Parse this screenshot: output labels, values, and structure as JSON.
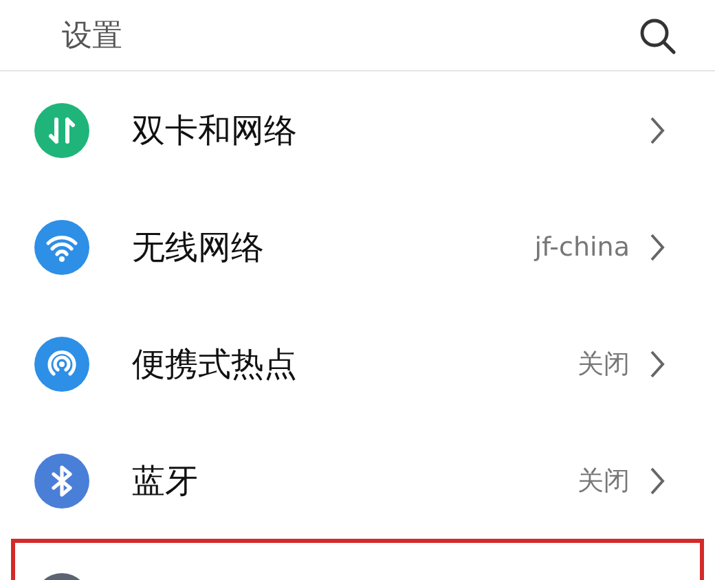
{
  "header": {
    "title": "设置"
  },
  "items": [
    {
      "kind": "dual-sim",
      "label": "双卡和网络",
      "highlighted": false
    },
    {
      "kind": "wifi",
      "label": "无线网络",
      "value": "jf-china",
      "highlighted": false
    },
    {
      "kind": "hotspot",
      "label": "便携式热点",
      "value": "关闭",
      "highlighted": false
    },
    {
      "kind": "bluetooth",
      "label": "蓝牙",
      "value": "关闭",
      "highlighted": false
    },
    {
      "kind": "gray",
      "highlighted": true
    }
  ]
}
